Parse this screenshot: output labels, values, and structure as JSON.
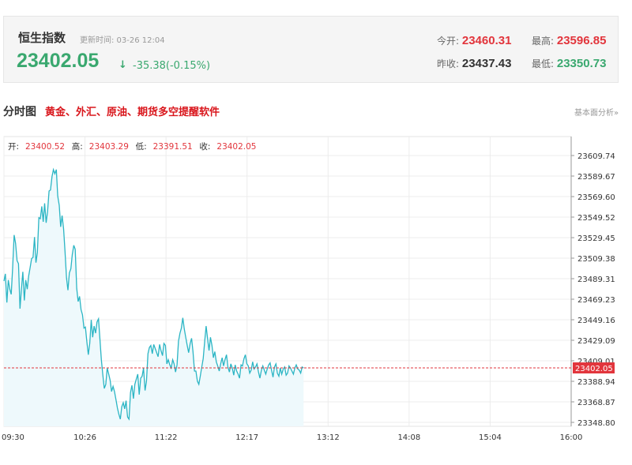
{
  "quote": {
    "name": "恒生指数",
    "update_label": "更新时间: 03-26 12:04",
    "price": "23402.05",
    "arrow": "↓",
    "change": "-35.38(-0.15%)",
    "open_label": "今开:",
    "open": "23460.31",
    "high_label": "最高:",
    "high": "23596.85",
    "prev_close_label": "昨收:",
    "prev_close": "23437.43",
    "low_label": "最低:",
    "low": "23350.73"
  },
  "section": {
    "title": "分时图",
    "promo": "黄金、外汇、原油、期货多空提醒软件",
    "right_link": "基本面分析»"
  },
  "colors": {
    "line": "#2bb5c4",
    "fill": "#eef9fc",
    "ref_line": "#e2353c",
    "up": "#e2353c",
    "down": "#3aa86f"
  },
  "chart_data": {
    "type": "area",
    "info": [
      {
        "label": "开:",
        "value": "23400.52"
      },
      {
        "label": "高:",
        "value": "23403.29"
      },
      {
        "label": "低:",
        "value": "23391.51"
      },
      {
        "label": "收:",
        "value": "23402.05"
      }
    ],
    "y_ticks": [
      "23609.74",
      "23589.67",
      "23569.60",
      "23549.52",
      "23529.45",
      "23509.38",
      "23489.31",
      "23469.23",
      "23449.16",
      "23429.09",
      "23409.01",
      "23388.94",
      "23368.87",
      "23348.80"
    ],
    "ylim": [
      23348.8,
      23609.74
    ],
    "x_ticks": [
      "09:30",
      "10:26",
      "11:22",
      "12:17",
      "13:12",
      "14:08",
      "15:04",
      "16:00"
    ],
    "current_value": "23402.05",
    "series": [
      {
        "x_start": "09:30",
        "interval_minutes": 1,
        "values": [
          23487,
          23494,
          23466,
          23488,
          23479,
          23474,
          23500,
          23532,
          23524,
          23507,
          23504,
          23460,
          23479,
          23496,
          23468,
          23488,
          23479,
          23492,
          23500,
          23509,
          23510,
          23530,
          23505,
          23515,
          23549,
          23548,
          23560,
          23545,
          23563,
          23544,
          23555,
          23575,
          23576,
          23589,
          23596,
          23592,
          23596,
          23570,
          23561,
          23540,
          23551,
          23538,
          23516,
          23490,
          23478,
          23495,
          23499,
          23513,
          23522,
          23518,
          23480,
          23467,
          23472,
          23459,
          23454,
          23441,
          23442,
          23428,
          23415,
          23426,
          23449,
          23432,
          23443,
          23436,
          23447,
          23450,
          23430,
          23410,
          23395,
          23382,
          23386,
          23402,
          23396,
          23390,
          23379,
          23384,
          23379,
          23371,
          23363,
          23357,
          23352,
          23364,
          23368,
          23362,
          23370,
          23354,
          23352,
          23378,
          23385,
          23372,
          23386,
          23391,
          23396,
          23376,
          23392,
          23394,
          23402,
          23380,
          23389,
          23416,
          23422,
          23424,
          23416,
          23425,
          23421,
          23417,
          23413,
          23425,
          23419,
          23414,
          23426,
          23424,
          23406,
          23410,
          23405,
          23402,
          23410,
          23406,
          23398,
          23405,
          23428,
          23436,
          23441,
          23451,
          23440,
          23432,
          23424,
          23417,
          23426,
          23431,
          23418,
          23399,
          23399,
          23389,
          23386,
          23394,
          23403,
          23411,
          23428,
          23443,
          23431,
          23419,
          23432,
          23424,
          23412,
          23418,
          23408,
          23404,
          23399,
          23406,
          23412,
          23404,
          23410,
          23415,
          23403,
          23398,
          23406,
          23402,
          23395,
          23405,
          23399,
          23396,
          23392,
          23405,
          23404,
          23411,
          23415,
          23406,
          23404,
          23397,
          23400,
          23408,
          23401,
          23403,
          23406,
          23398,
          23392,
          23400,
          23404,
          23400,
          23396,
          23401,
          23405,
          23407,
          23400,
          23393,
          23403,
          23406,
          23397,
          23394,
          23402,
          23396,
          23401,
          23403,
          23395,
          23397,
          23404,
          23402,
          23399,
          23396,
          23402,
          23405,
          23401,
          23400,
          23397,
          23403,
          23402
        ]
      }
    ]
  }
}
